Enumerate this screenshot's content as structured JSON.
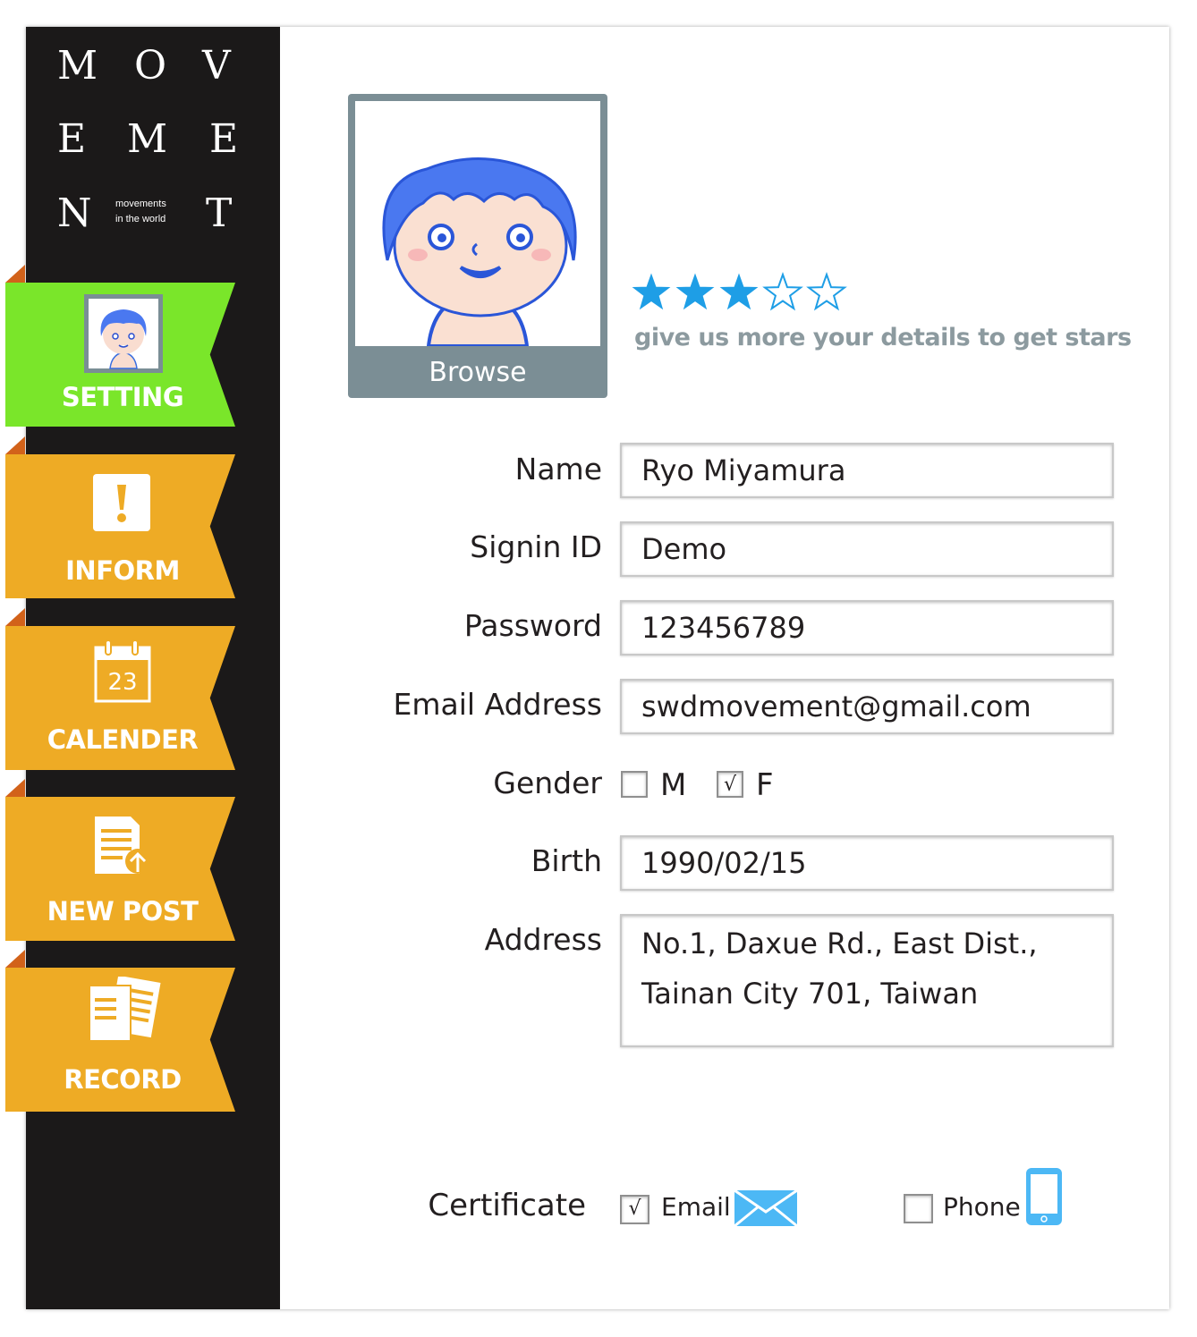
{
  "brand": {
    "letters": [
      "M",
      "O",
      "V",
      "E",
      "M",
      "E",
      "N",
      "T"
    ],
    "tagline_line1": "movements",
    "tagline_line2": "in the world"
  },
  "nav": {
    "items": [
      {
        "label": "SETTING",
        "icon": "avatar-icon",
        "color": "#7ae62a",
        "active": true
      },
      {
        "label": "INFORM",
        "icon": "exclamation-icon",
        "color": "#eeab25",
        "active": false
      },
      {
        "label": "CALENDER",
        "icon": "calendar-icon",
        "color": "#eeab25",
        "active": false,
        "icon_text": "23"
      },
      {
        "label": "NEW POST",
        "icon": "document-upload-icon",
        "color": "#eeab25",
        "active": false
      },
      {
        "label": "RECORD",
        "icon": "documents-icon",
        "color": "#eeab25",
        "active": false
      }
    ]
  },
  "profile": {
    "browse_label": "Browse",
    "rating": {
      "value": 3,
      "max": 5,
      "color": "#1e9ee6"
    },
    "hint": "give us more your details to get stars"
  },
  "form": {
    "name": {
      "label": "Name",
      "value": "Ryo Miyamura"
    },
    "signin": {
      "label": "Signin ID",
      "value": "Demo"
    },
    "password": {
      "label": "Password",
      "value": "123456789"
    },
    "email": {
      "label": "Email Address",
      "value": "swdmovement@gmail.com"
    },
    "gender": {
      "label": "Gender",
      "options": [
        {
          "label": "M",
          "checked": false
        },
        {
          "label": "F",
          "checked": true
        }
      ]
    },
    "birth": {
      "label": "Birth",
      "value": "1990/02/15"
    },
    "address": {
      "label": "Address",
      "line1": "No.1, Daxue Rd., East Dist.,",
      "line2": "Tainan City 701, Taiwan"
    },
    "certificate": {
      "label": "Certificate",
      "options": [
        {
          "label": "Email",
          "checked": true,
          "icon": "envelope-icon"
        },
        {
          "label": "Phone",
          "checked": false,
          "icon": "phone-icon"
        }
      ]
    }
  },
  "check_mark": "√",
  "colors": {
    "accent_green": "#7ae62a",
    "accent_orange": "#eeab25",
    "sidebar": "#1b1919",
    "icon_blue": "#4cb8f5"
  }
}
